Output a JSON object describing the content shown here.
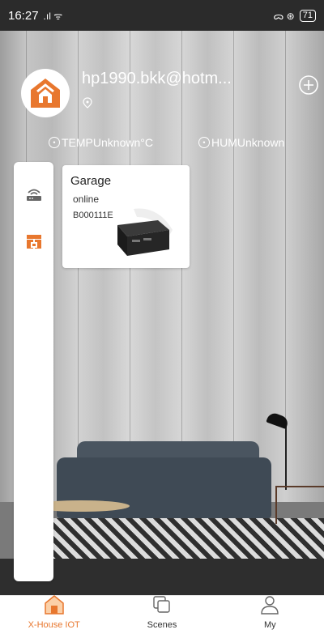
{
  "status_bar": {
    "time": "16:27",
    "left_icons": ".ıl ᯤ",
    "right_icons": "ᯅ ⊛",
    "battery": "71"
  },
  "header": {
    "username": "hp1990.bkk@hotm...",
    "temperature": "TEMPUnknown°C",
    "humidity": "HUMUnknown"
  },
  "categories": [
    {
      "icon": "router-icon",
      "active": false
    },
    {
      "icon": "gateway-icon",
      "active": true
    }
  ],
  "devices": [
    {
      "name": "Garage",
      "status": "online",
      "serial": "B000111E",
      "image": "device-box-icon"
    }
  ],
  "bottom_nav": {
    "items": [
      {
        "label": "X-House IOT",
        "icon": "home-icon",
        "active": true
      },
      {
        "label": "Scenes",
        "icon": "scenes-icon",
        "active": false
      },
      {
        "label": "My",
        "icon": "profile-icon",
        "active": false
      }
    ]
  },
  "colors": {
    "accent": "#e8772e",
    "status_bar": "#2b2b2b",
    "card": "#ffffff"
  }
}
